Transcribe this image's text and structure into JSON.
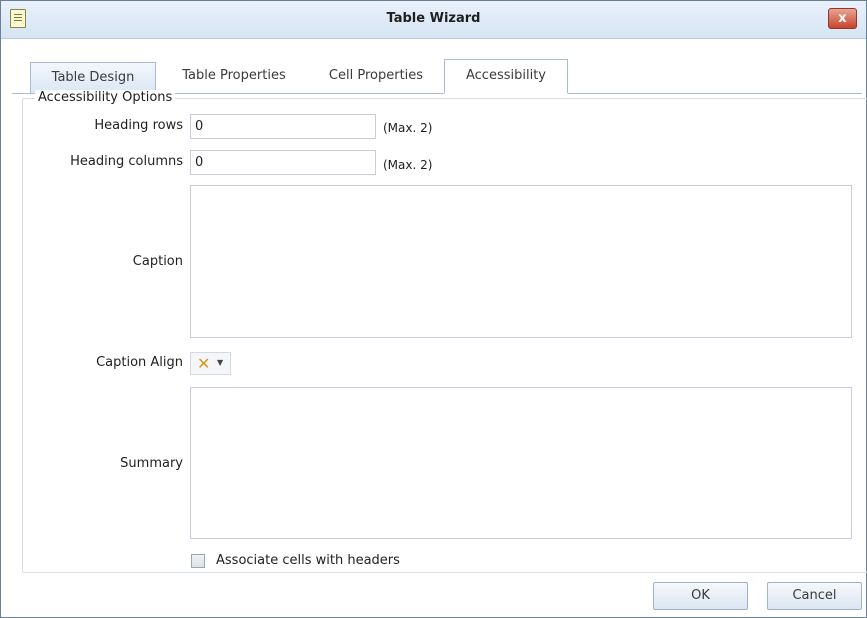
{
  "window": {
    "title": "Table Wizard",
    "close_glyph": "x"
  },
  "tabs": [
    {
      "label": "Table Design"
    },
    {
      "label": "Table Properties"
    },
    {
      "label": "Cell Properties"
    },
    {
      "label": "Accessibility"
    }
  ],
  "group": {
    "legend": "Accessibility Options"
  },
  "fields": {
    "heading_rows": {
      "label": "Heading rows",
      "value": "0",
      "hint": "(Max. 2)"
    },
    "heading_columns": {
      "label": "Heading columns",
      "value": "0",
      "hint": "(Max. 2)"
    },
    "caption": {
      "label": "Caption",
      "value": ""
    },
    "caption_align": {
      "label": "Caption Align",
      "selected_icon": "x-icon"
    },
    "summary": {
      "label": "Summary",
      "value": ""
    },
    "associate_cells": {
      "label": "Associate cells with headers",
      "checked": false
    }
  },
  "buttons": {
    "ok": "OK",
    "cancel": "Cancel"
  },
  "colors": {
    "accent": "#a9bcd4",
    "close": "#c8452d"
  }
}
